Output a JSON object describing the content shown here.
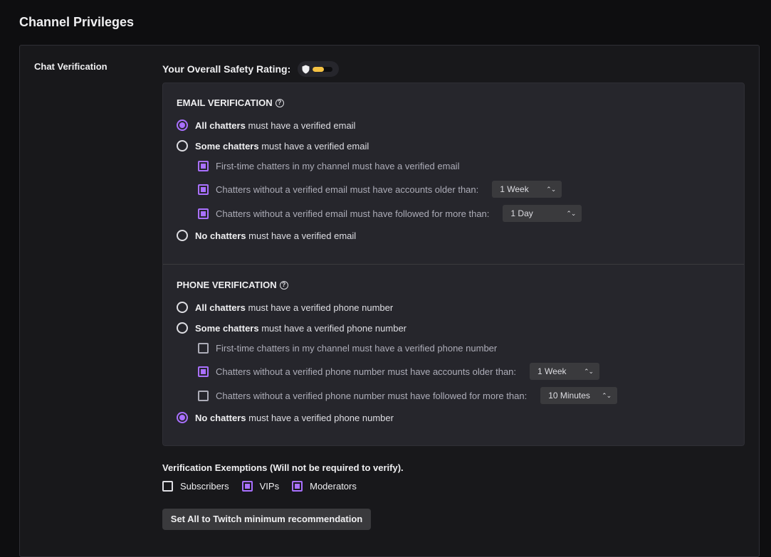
{
  "page_title": "Channel Privileges",
  "section_label": "Chat Verification",
  "rating": {
    "label": "Your Overall Safety Rating:",
    "level": 0.55,
    "color": "#f5c243"
  },
  "email": {
    "title": "EMAIL VERIFICATION",
    "options": [
      {
        "strong": "All chatters",
        "rest": "must have a verified email",
        "selected": true
      },
      {
        "strong": "Some chatters",
        "rest": "must have a verified email",
        "selected": false
      },
      {
        "strong": "No chatters",
        "rest": "must have a verified email",
        "selected": false
      }
    ],
    "sub": [
      {
        "label": "First-time chatters in my channel must have a verified email",
        "checked": true
      },
      {
        "label": "Chatters without a verified email must have accounts older than:",
        "checked": true,
        "select": "1 Week"
      },
      {
        "label": "Chatters without a verified email must have followed for more than:",
        "checked": true,
        "select": "1 Day"
      }
    ]
  },
  "phone": {
    "title": "PHONE VERIFICATION",
    "options": [
      {
        "strong": "All chatters",
        "rest": "must have a verified phone number",
        "selected": false
      },
      {
        "strong": "Some chatters",
        "rest": "must have a verified phone number",
        "selected": false
      },
      {
        "strong": "No chatters",
        "rest": "must have a verified phone number",
        "selected": true
      }
    ],
    "sub": [
      {
        "label": "First-time chatters in my channel must have a verified phone number",
        "checked": false
      },
      {
        "label": "Chatters without a verified phone number must have accounts older than:",
        "checked": true,
        "select": "1 Week"
      },
      {
        "label": "Chatters without a verified phone number must have followed for more than:",
        "checked": false,
        "select": "10 Minutes"
      }
    ]
  },
  "exemptions": {
    "title": "Verification Exemptions (Will not be required to verify).",
    "items": [
      {
        "label": "Subscribers",
        "checked": false
      },
      {
        "label": "VIPs",
        "checked": true
      },
      {
        "label": "Moderators",
        "checked": true
      }
    ]
  },
  "cta_label": "Set All to Twitch minimum recommendation",
  "colors": {
    "accent": "#a970ff",
    "background": "#0e0e10",
    "panel": "#18181b",
    "box": "#26262c"
  }
}
